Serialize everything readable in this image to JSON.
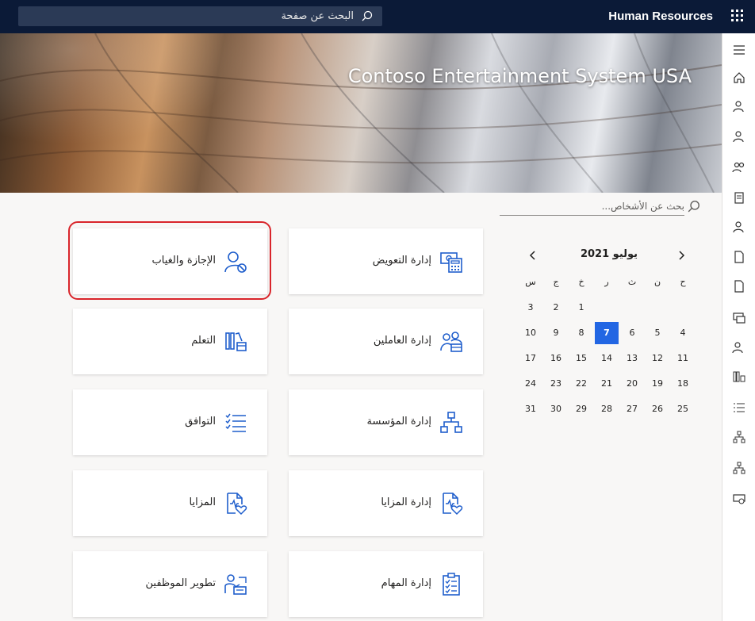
{
  "header": {
    "app_title": "Human Resources",
    "search_placeholder": "البحث عن صفحة"
  },
  "banner": {
    "title": "Contoso Entertainment System USA"
  },
  "people_search": {
    "placeholder": "بحث عن الأشخاص..."
  },
  "calendar": {
    "month": "يوليو",
    "year": "2021",
    "weekdays": [
      "ح",
      "ن",
      "ث",
      "ر",
      "خ",
      "ج",
      "س"
    ],
    "weeks": [
      [
        "",
        "",
        "",
        "",
        "1",
        "2",
        "3"
      ],
      [
        "4",
        "5",
        "6",
        "7",
        "8",
        "9",
        "10"
      ],
      [
        "11",
        "12",
        "13",
        "14",
        "15",
        "16",
        "17"
      ],
      [
        "18",
        "19",
        "20",
        "21",
        "22",
        "23",
        "24"
      ],
      [
        "25",
        "26",
        "27",
        "28",
        "29",
        "30",
        "31"
      ]
    ],
    "selected_day": "7",
    "accent_color": "#2266e3"
  },
  "tiles": {
    "compensation": {
      "label": "إدارة التعويض",
      "icon": "compensation-icon"
    },
    "leave": {
      "label": "الإجازة والغياب",
      "icon": "leave-absence-icon"
    },
    "workers": {
      "label": "إدارة العاملين",
      "icon": "workers-icon"
    },
    "learning": {
      "label": "التعلم",
      "icon": "learning-icon"
    },
    "organization": {
      "label": "إدارة المؤسسة",
      "icon": "org-chart-icon"
    },
    "compliance": {
      "label": "التوافق",
      "icon": "compliance-list-icon"
    },
    "benefits_mgmt": {
      "label": "إدارة المزايا",
      "icon": "benefits-icon"
    },
    "benefits": {
      "label": "المزايا",
      "icon": "benefits-icon"
    },
    "tasks": {
      "label": "إدارة المهام",
      "icon": "task-clipboard-icon"
    },
    "development": {
      "label": "تطوير الموظفين",
      "icon": "employee-development-icon"
    }
  },
  "highlight_color": "#d9252b"
}
